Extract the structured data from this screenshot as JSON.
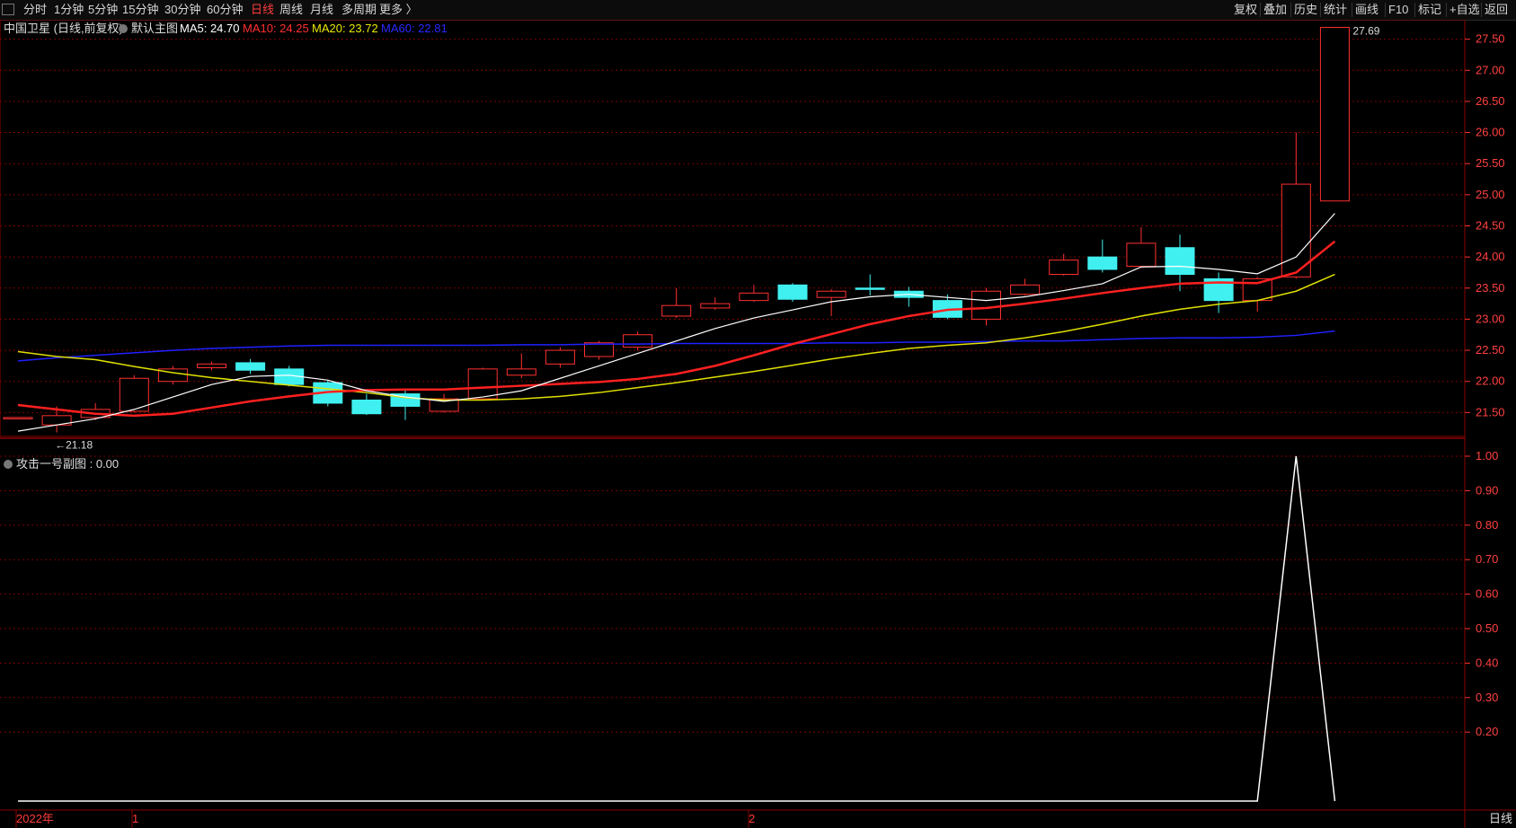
{
  "toolbar": {
    "periods": [
      "分时",
      "1分钟",
      "5分钟",
      "15分钟",
      "30分钟",
      "60分钟",
      "日线",
      "周线",
      "月线",
      "多周期",
      "更多 〉"
    ],
    "active_period": "日线",
    "right_items": [
      "复权",
      "叠加",
      "历史",
      "统计",
      "画线",
      "F10",
      "标记",
      "+自选",
      "返回"
    ]
  },
  "main_chart": {
    "stock_name": "中国卫星 (日线,前复权)",
    "template": "默认主图",
    "ma5_label": "MA5: 24.70",
    "ma10_label": "MA10: 24.25",
    "ma20_label": "MA20: 23.72",
    "ma60_label": "MA60: 22.81",
    "high_marker": "27.69",
    "low_marker": "←21.18",
    "y_ticks": [
      "27.50",
      "27.00",
      "26.50",
      "26.00",
      "25.50",
      "25.00",
      "24.50",
      "24.00",
      "23.50",
      "23.00",
      "22.50",
      "22.00",
      "21.50"
    ]
  },
  "sub_chart": {
    "title": "攻击一号副图 : 0.00",
    "y_ticks": [
      "1.00",
      "0.90",
      "0.80",
      "0.70",
      "0.60",
      "0.50",
      "0.40",
      "0.30",
      "0.20"
    ]
  },
  "date_axis": {
    "year_label": "2022年",
    "month1": "1",
    "month2": "2",
    "period_tag": "日线"
  },
  "colors": {
    "up": "#ff3030",
    "down": "#40f0f0",
    "ma5": "#ffffff",
    "ma10": "#ff2020",
    "ma20": "#e0e000",
    "ma60": "#2020ff",
    "grid": "#7a0000"
  },
  "chart_data": {
    "type": "candlestick",
    "candles": [
      {
        "o": 21.42,
        "c": 21.42,
        "h": 21.42,
        "l": 21.42
      },
      {
        "o": 21.3,
        "c": 21.45,
        "h": 21.6,
        "l": 21.18
      },
      {
        "o": 21.42,
        "c": 21.55,
        "h": 21.65,
        "l": 21.38
      },
      {
        "o": 21.52,
        "c": 22.05,
        "h": 22.1,
        "l": 21.5
      },
      {
        "o": 22.0,
        "c": 22.2,
        "h": 22.25,
        "l": 21.95
      },
      {
        "o": 22.22,
        "c": 22.28,
        "h": 22.32,
        "l": 22.18
      },
      {
        "o": 22.3,
        "c": 22.18,
        "h": 22.36,
        "l": 22.12
      },
      {
        "o": 22.2,
        "c": 21.95,
        "h": 22.25,
        "l": 21.92
      },
      {
        "o": 21.98,
        "c": 21.65,
        "h": 22.02,
        "l": 21.6
      },
      {
        "o": 21.7,
        "c": 21.48,
        "h": 21.8,
        "l": 21.46
      },
      {
        "o": 21.8,
        "c": 21.6,
        "h": 21.85,
        "l": 21.38
      },
      {
        "o": 21.52,
        "c": 21.72,
        "h": 21.8,
        "l": 21.5
      },
      {
        "o": 21.72,
        "c": 22.2,
        "h": 22.22,
        "l": 21.7
      },
      {
        "o": 22.1,
        "c": 22.2,
        "h": 22.45,
        "l": 22.05
      },
      {
        "o": 22.28,
        "c": 22.5,
        "h": 22.55,
        "l": 22.22
      },
      {
        "o": 22.4,
        "c": 22.62,
        "h": 22.65,
        "l": 22.35
      },
      {
        "o": 22.55,
        "c": 22.75,
        "h": 22.8,
        "l": 22.5
      },
      {
        "o": 23.05,
        "c": 23.22,
        "h": 23.5,
        "l": 23.02
      },
      {
        "o": 23.18,
        "c": 23.25,
        "h": 23.35,
        "l": 23.15
      },
      {
        "o": 23.3,
        "c": 23.42,
        "h": 23.55,
        "l": 23.28
      },
      {
        "o": 23.55,
        "c": 23.32,
        "h": 23.58,
        "l": 23.28
      },
      {
        "o": 23.35,
        "c": 23.45,
        "h": 23.48,
        "l": 23.05
      },
      {
        "o": 23.5,
        "c": 23.48,
        "h": 23.72,
        "l": 23.38
      },
      {
        "o": 23.45,
        "c": 23.35,
        "h": 23.52,
        "l": 23.2
      },
      {
        "o": 23.3,
        "c": 23.03,
        "h": 23.4,
        "l": 23.0
      },
      {
        "o": 23.0,
        "c": 23.45,
        "h": 23.5,
        "l": 22.9
      },
      {
        "o": 23.4,
        "c": 23.55,
        "h": 23.65,
        "l": 23.38
      },
      {
        "o": 23.72,
        "c": 23.95,
        "h": 24.05,
        "l": 23.7
      },
      {
        "o": 24.0,
        "c": 23.8,
        "h": 24.28,
        "l": 23.75
      },
      {
        "o": 23.85,
        "c": 24.22,
        "h": 24.48,
        "l": 23.82
      },
      {
        "o": 24.15,
        "c": 23.72,
        "h": 24.36,
        "l": 23.45
      },
      {
        "o": 23.65,
        "c": 23.3,
        "h": 23.75,
        "l": 23.1
      },
      {
        "o": 23.3,
        "c": 23.65,
        "h": 23.68,
        "l": 23.12
      },
      {
        "o": 23.68,
        "c": 25.17,
        "h": 26.0,
        "l": 23.65
      },
      {
        "o": 24.9,
        "c": 27.69,
        "h": 27.69,
        "l": 24.9
      }
    ],
    "ma5": [
      21.2,
      21.3,
      21.4,
      21.55,
      21.75,
      21.95,
      22.08,
      22.1,
      22.02,
      21.85,
      21.75,
      21.68,
      21.75,
      21.85,
      22.05,
      22.25,
      22.45,
      22.65,
      22.85,
      23.02,
      23.15,
      23.28,
      23.36,
      23.4,
      23.35,
      23.3,
      23.36,
      23.46,
      23.57,
      23.84,
      23.85,
      23.8,
      23.73,
      24.0,
      24.7
    ],
    "ma10": [
      21.62,
      21.55,
      21.48,
      21.45,
      21.48,
      21.58,
      21.68,
      21.76,
      21.83,
      21.86,
      21.87,
      21.87,
      21.9,
      21.93,
      21.96,
      21.99,
      22.04,
      22.12,
      22.25,
      22.42,
      22.6,
      22.76,
      22.92,
      23.05,
      23.15,
      23.18,
      23.25,
      23.33,
      23.42,
      23.5,
      23.57,
      23.59,
      23.58,
      23.75,
      24.25
    ],
    "ma20": [
      22.48,
      22.4,
      22.35,
      22.24,
      22.14,
      22.06,
      22.0,
      21.94,
      21.88,
      21.82,
      21.74,
      21.7,
      21.7,
      21.72,
      21.76,
      21.82,
      21.9,
      21.98,
      22.07,
      22.16,
      22.26,
      22.36,
      22.45,
      22.53,
      22.58,
      22.62,
      22.7,
      22.8,
      22.92,
      23.05,
      23.16,
      23.24,
      23.3,
      23.45,
      23.72
    ],
    "ma60": [
      22.33,
      22.38,
      22.42,
      22.46,
      22.5,
      22.53,
      22.55,
      22.57,
      22.58,
      22.58,
      22.58,
      22.58,
      22.58,
      22.59,
      22.59,
      22.6,
      22.6,
      22.61,
      22.61,
      22.61,
      22.61,
      22.62,
      22.62,
      22.63,
      22.63,
      22.64,
      22.65,
      22.65,
      22.67,
      22.69,
      22.7,
      22.7,
      22.71,
      22.74,
      22.81
    ],
    "sub_values": [
      0,
      0,
      0,
      0,
      0,
      0,
      0,
      0,
      0,
      0,
      0,
      0,
      0,
      0,
      0,
      0,
      0,
      0,
      0,
      0,
      0,
      0,
      0,
      0,
      0,
      0,
      0,
      0,
      0,
      0,
      0,
      0,
      0,
      1,
      0
    ],
    "sub_start_x_value": 0
  }
}
